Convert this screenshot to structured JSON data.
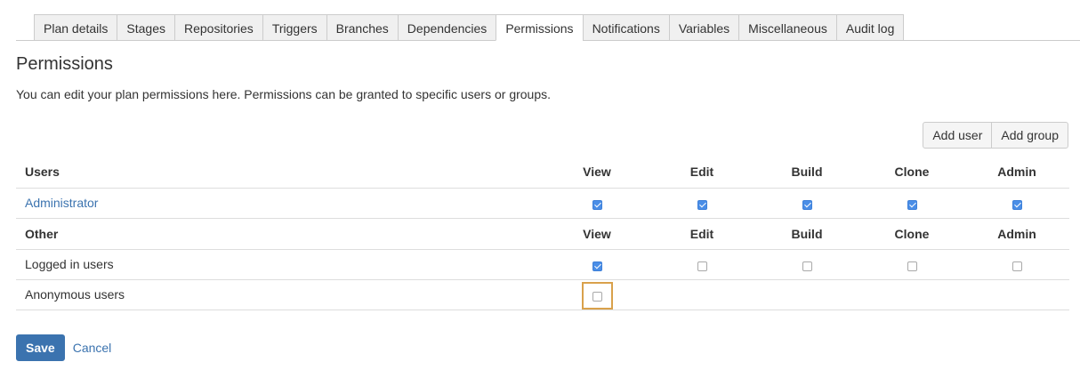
{
  "tabs": [
    "Plan details",
    "Stages",
    "Repositories",
    "Triggers",
    "Branches",
    "Dependencies",
    "Permissions",
    "Notifications",
    "Variables",
    "Miscellaneous",
    "Audit log"
  ],
  "active_tab": "Permissions",
  "page_title": "Permissions",
  "intro": "You can edit your plan permissions here. Permissions can be granted to specific users or groups.",
  "buttons": {
    "add_user": "Add user",
    "add_group": "Add group"
  },
  "columns": [
    "View",
    "Edit",
    "Build",
    "Clone",
    "Admin"
  ],
  "users_section": {
    "header": "Users",
    "rows": [
      {
        "name": "Administrator",
        "is_link": true,
        "checks": [
          true,
          true,
          true,
          true,
          true
        ]
      }
    ]
  },
  "other_section": {
    "header": "Other",
    "rows": [
      {
        "name": "Logged in users",
        "checks": [
          true,
          false,
          false,
          false,
          false
        ]
      },
      {
        "name": "Anonymous users",
        "checks": [
          false
        ],
        "focused_index": 0
      }
    ]
  },
  "footer": {
    "save": "Save",
    "cancel": "Cancel"
  },
  "colors": {
    "primary": "#3b73af",
    "checkbox_checked": "#4a8ee7",
    "focus_ring": "#d9a14b"
  }
}
